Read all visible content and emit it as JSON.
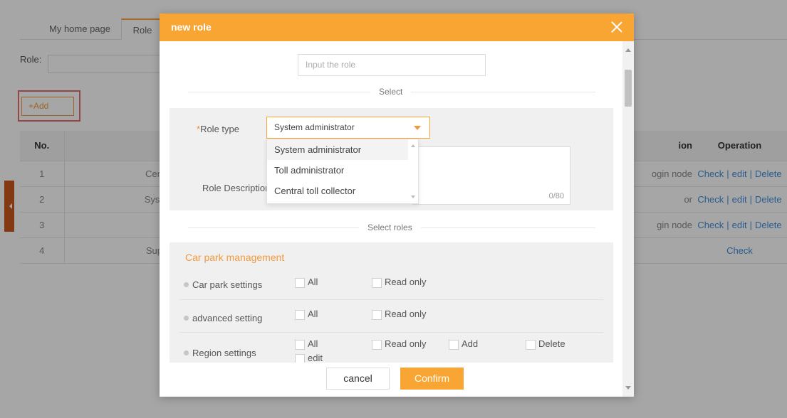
{
  "tabs": [
    {
      "label": "My home page"
    },
    {
      "label": "Role"
    }
  ],
  "filter": {
    "label": "Role:"
  },
  "toolbar": {
    "add_label": "+Add"
  },
  "table": {
    "headers": {
      "no": "No.",
      "name_frag": "",
      "desc_frag": "ion",
      "operation": "Operation"
    },
    "rows": [
      {
        "no": "1",
        "name_frag": "Cen",
        "desc_frag": "ogin node",
        "ops": [
          "Check",
          "edit",
          "Delete"
        ]
      },
      {
        "no": "2",
        "name_frag": "Syst",
        "desc_frag": "or",
        "ops": [
          "Check",
          "edit",
          "Delete"
        ]
      },
      {
        "no": "3",
        "name_frag": "",
        "desc_frag": "gin node",
        "ops": [
          "Check",
          "edit",
          "Delete"
        ]
      },
      {
        "no": "4",
        "name_frag": "Sup",
        "desc_frag": "",
        "ops": [
          "Check"
        ]
      }
    ]
  },
  "modal": {
    "title": "new role",
    "role_input_placeholder": "Input the role",
    "section_select": "Select",
    "role_type_required_mark": "*",
    "role_type_label": "Role type",
    "role_type_selected": "System administrator",
    "role_type_options": [
      "System administrator",
      "Toll administrator",
      "Central toll collector"
    ],
    "role_description_label": "Role Description",
    "description_count": "0/80",
    "section_select_roles": "Select roles",
    "perm_group_title": "Car park management",
    "permissions": [
      {
        "name": "Car park settings",
        "options": [
          "All",
          "Read only"
        ]
      },
      {
        "name": "advanced setting",
        "options": [
          "All",
          "Read only"
        ]
      },
      {
        "name": "Region settings",
        "options": [
          "All",
          "Read only",
          "Add",
          "Delete",
          "edit"
        ]
      }
    ],
    "cancel_label": "cancel",
    "confirm_label": "Confirm"
  },
  "colors": {
    "accent": "#f8a534",
    "link": "#3f8ed9",
    "highlight_box": "#e56a6a"
  }
}
